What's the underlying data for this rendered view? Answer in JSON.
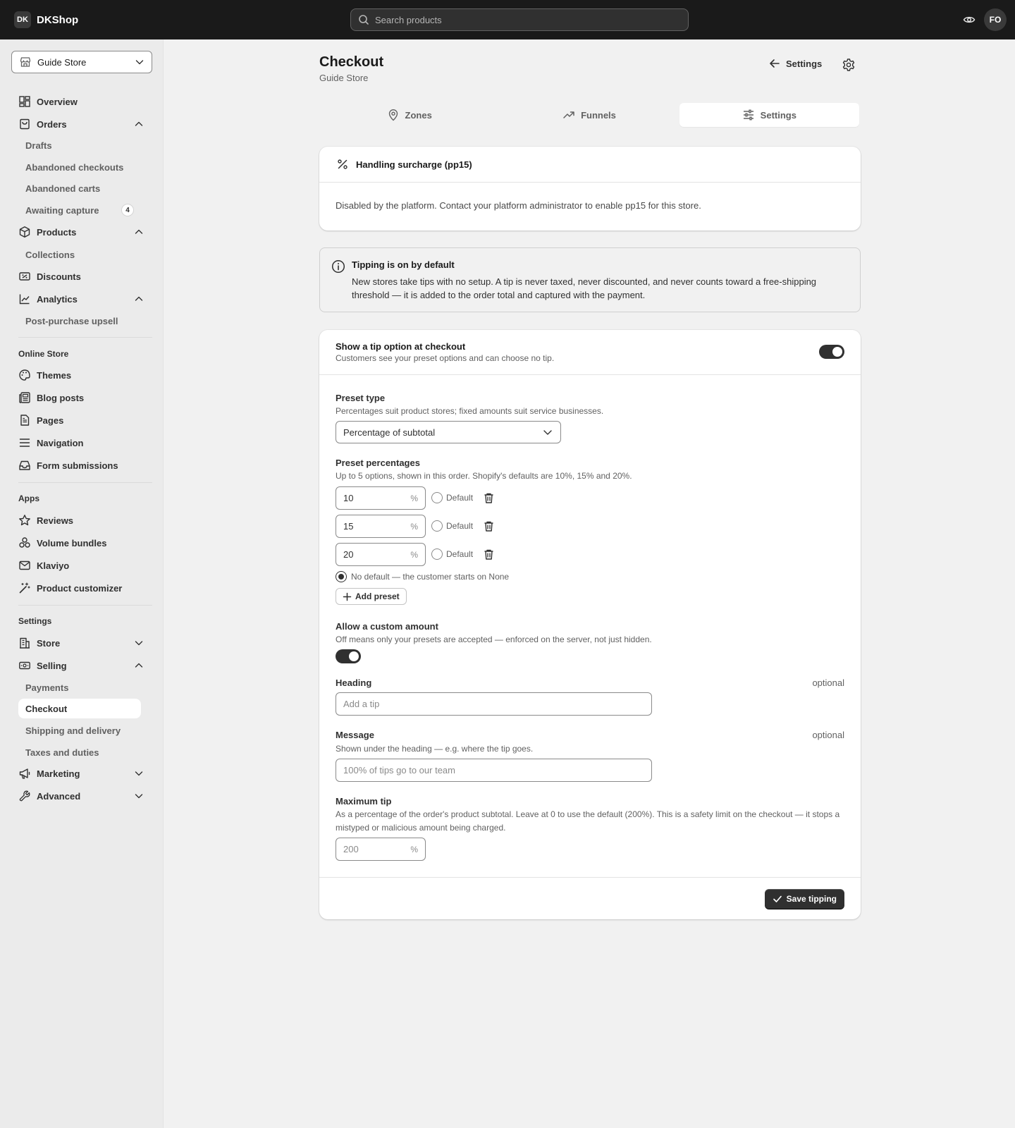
{
  "topbar": {
    "brand_badge": "DK",
    "brand_name": "DKShop",
    "search_placeholder": "Search products",
    "avatar_initials": "FO"
  },
  "sidebar": {
    "store_name": "Guide Store",
    "items": {
      "overview": "Overview",
      "orders": "Orders",
      "drafts": "Drafts",
      "abandoned_checkouts": "Abandoned checkouts",
      "abandoned_carts": "Abandoned carts",
      "awaiting_capture": "Awaiting capture",
      "awaiting_capture_count": "4",
      "products": "Products",
      "collections": "Collections",
      "discounts": "Discounts",
      "analytics": "Analytics",
      "post_purchase_upsell": "Post-purchase upsell"
    },
    "online_store": {
      "heading": "Online Store",
      "themes": "Themes",
      "blog_posts": "Blog posts",
      "pages": "Pages",
      "navigation": "Navigation",
      "form_submissions": "Form submissions"
    },
    "apps": {
      "heading": "Apps",
      "reviews": "Reviews",
      "volume_bundles": "Volume bundles",
      "klaviyo": "Klaviyo",
      "product_customizer": "Product customizer"
    },
    "settings": {
      "heading": "Settings",
      "store": "Store",
      "selling": "Selling",
      "payments": "Payments",
      "checkout": "Checkout",
      "shipping": "Shipping and delivery",
      "taxes": "Taxes and duties",
      "marketing": "Marketing",
      "advanced": "Advanced"
    }
  },
  "header": {
    "title": "Checkout",
    "subtitle": "Guide Store",
    "back_label": "Settings"
  },
  "tabs": {
    "zones": "Zones",
    "funnels": "Funnels",
    "settings": "Settings",
    "active": "settings"
  },
  "surcharge": {
    "title": "Handling surcharge (pp15)",
    "message": "Disabled by the platform. Contact your platform administrator to enable pp15 for this store."
  },
  "banner": {
    "title": "Tipping is on by default",
    "body": "New stores take tips with no setup. A tip is never taxed, never discounted, and never counts toward a free-shipping threshold — it is added to the order total and captured with the payment."
  },
  "tipping": {
    "show_title": "Show a tip option at checkout",
    "show_help": "Customers see your preset options and can choose no tip.",
    "show_enabled": true,
    "preset_type_label": "Preset type",
    "preset_type_help": "Percentages suit product stores; fixed amounts suit service businesses.",
    "preset_type_value": "Percentage of subtotal",
    "preset_pct_label": "Preset percentages",
    "preset_pct_help": "Up to 5 options, shown in this order. Shopify's defaults are 10%, 15% and 20%.",
    "presets": [
      {
        "value": "10",
        "suffix": "%",
        "default_label": "Default"
      },
      {
        "value": "15",
        "suffix": "%",
        "default_label": "Default"
      },
      {
        "value": "20",
        "suffix": "%",
        "default_label": "Default"
      }
    ],
    "no_default_label": "No default — the customer starts on None",
    "add_preset_label": "Add preset",
    "custom_label": "Allow a custom amount",
    "custom_help": "Off means only your presets are accepted — enforced on the server, not just hidden.",
    "custom_enabled": true,
    "heading_label": "Heading",
    "heading_optional": "optional",
    "heading_placeholder": "Add a tip",
    "message_label": "Message",
    "message_optional": "optional",
    "message_help": "Shown under the heading — e.g. where the tip goes.",
    "message_placeholder": "100% of tips go to our team",
    "max_label": "Maximum tip",
    "max_help": "As a percentage of the order's product subtotal. Leave at 0 to use the default (200%). This is a safety limit on the checkout — it stops a mistyped or malicious amount being charged.",
    "max_placeholder": "200",
    "max_suffix": "%",
    "save_label": "Save tipping"
  }
}
